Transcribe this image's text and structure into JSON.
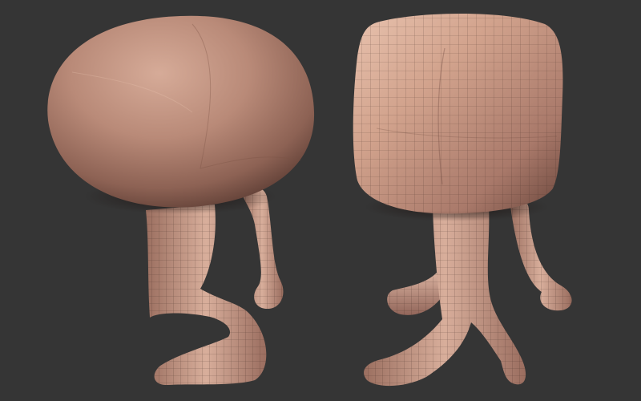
{
  "scene": {
    "background_color": "#353535",
    "clay_color": "#c49583",
    "clay_highlight": "#e2bba9",
    "clay_shadow": "#6f4a3f",
    "wire_color": "#3a2620",
    "models": [
      {
        "name": "round-head-character",
        "head_shape": "ellipsoid",
        "wireframe_on_head": false,
        "wireframe_on_legs": true
      },
      {
        "name": "box-head-character",
        "head_shape": "rounded-cube",
        "wireframe_on_head": true,
        "wireframe_on_legs": true
      }
    ]
  }
}
